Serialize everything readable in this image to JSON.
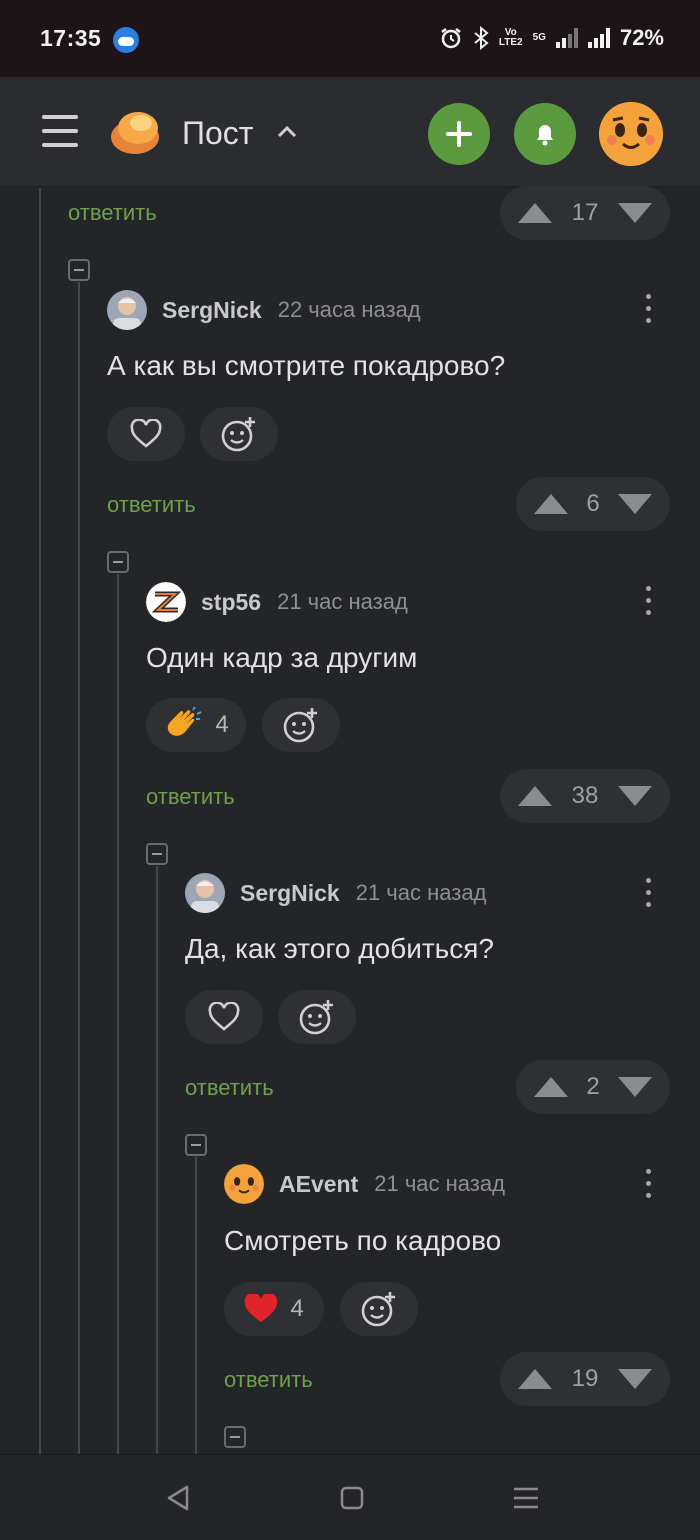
{
  "status": {
    "time": "17:35",
    "battery": "72%",
    "network": "5G",
    "volte": [
      "Vo",
      "LTE2"
    ]
  },
  "header": {
    "title": "Пост"
  },
  "colors": {
    "accent_green": "#5b9a3e",
    "reply_green": "#6ea14a",
    "bg": "#242528"
  },
  "reply_label": "ответить",
  "top_votes": {
    "count": "17"
  },
  "comments": [
    {
      "author": "SergNick",
      "time": "22 часа назад",
      "text": "А как вы смотрите покадрово?",
      "reaction": {
        "icon": "heart-outline-icon",
        "count": ""
      },
      "votes": "6"
    },
    {
      "author": "stp56",
      "time": "21 час назад",
      "text": "Один кадр за другим",
      "reaction": {
        "icon": "clapping-hands-icon",
        "count": "4"
      },
      "votes": "38"
    },
    {
      "author": "SergNick",
      "time": "21 час назад",
      "text": "Да, как этого добиться?",
      "reaction": {
        "icon": "heart-outline-icon",
        "count": ""
      },
      "votes": "2"
    },
    {
      "author": "AEvent",
      "time": "21 час назад",
      "text": "Смотреть по кадрово",
      "reaction": {
        "icon": "heart-filled-icon",
        "count": "4"
      },
      "votes": "19"
    }
  ]
}
